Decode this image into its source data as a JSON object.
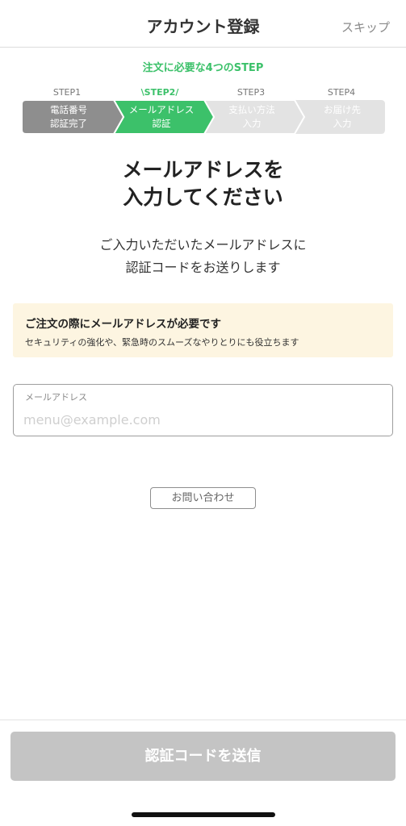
{
  "header": {
    "title": "アカウント登録",
    "skip_label": "スキップ"
  },
  "steps": {
    "heading": "注文に必要な4つのSTEP",
    "items": [
      {
        "label": "STEP1",
        "line1": "電話番号",
        "line2": "認証完了",
        "state": "done"
      },
      {
        "label": "\\STEP2/",
        "line1": "メールアドレス",
        "line2": "認証",
        "state": "current"
      },
      {
        "label": "STEP3",
        "line1": "支払い方法",
        "line2": "入力",
        "state": "pending"
      },
      {
        "label": "STEP4",
        "line1": "お届け先",
        "line2": "入力",
        "state": "pending"
      }
    ],
    "colors": {
      "done": "#8e8e8e",
      "current": "#3cc16a",
      "pending": "#e3e3e3"
    }
  },
  "main": {
    "title_line1": "メールアドレスを",
    "title_line2": "入力してください",
    "desc_line1": "ご入力いただいたメールアドレスに",
    "desc_line2": "認証コードをお送りします"
  },
  "notice": {
    "title": "ご注文の際にメールアドレスが必要です",
    "text": "セキュリティの強化や、緊急時のスムーズなやりとりにも役立ちます"
  },
  "email_field": {
    "label": "メールアドレス",
    "placeholder": "menu@example.com",
    "value": ""
  },
  "contact_label": "お問い合わせ",
  "submit_label": "認証コードを送信"
}
